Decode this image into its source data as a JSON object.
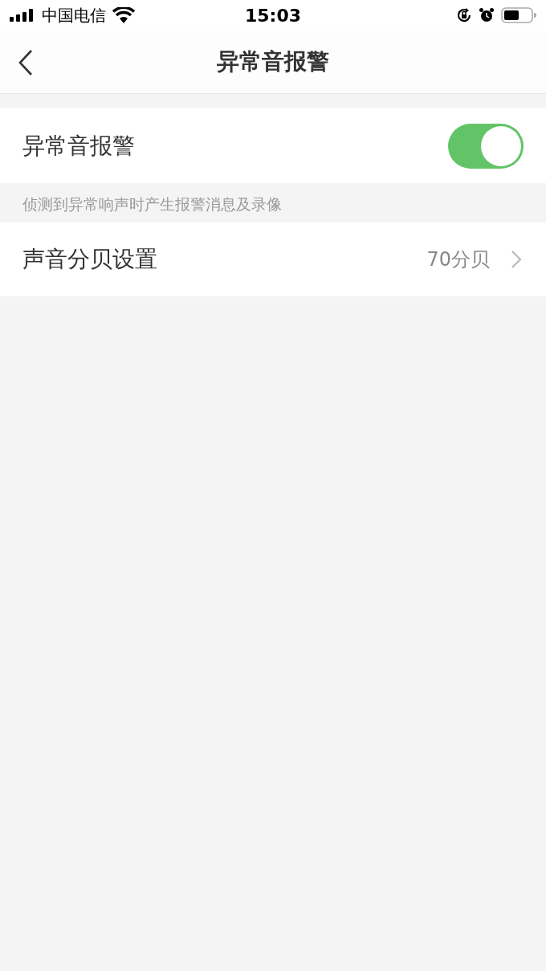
{
  "status_bar": {
    "carrier": "中国电信",
    "time": "15:03"
  },
  "nav_bar": {
    "title": "异常音报警"
  },
  "alarm_toggle": {
    "label": "异常音报警",
    "on": true
  },
  "description": "侦测到异常响声时产生报警消息及录像",
  "decibel_row": {
    "label": "声音分贝设置",
    "value": "70分贝"
  }
}
